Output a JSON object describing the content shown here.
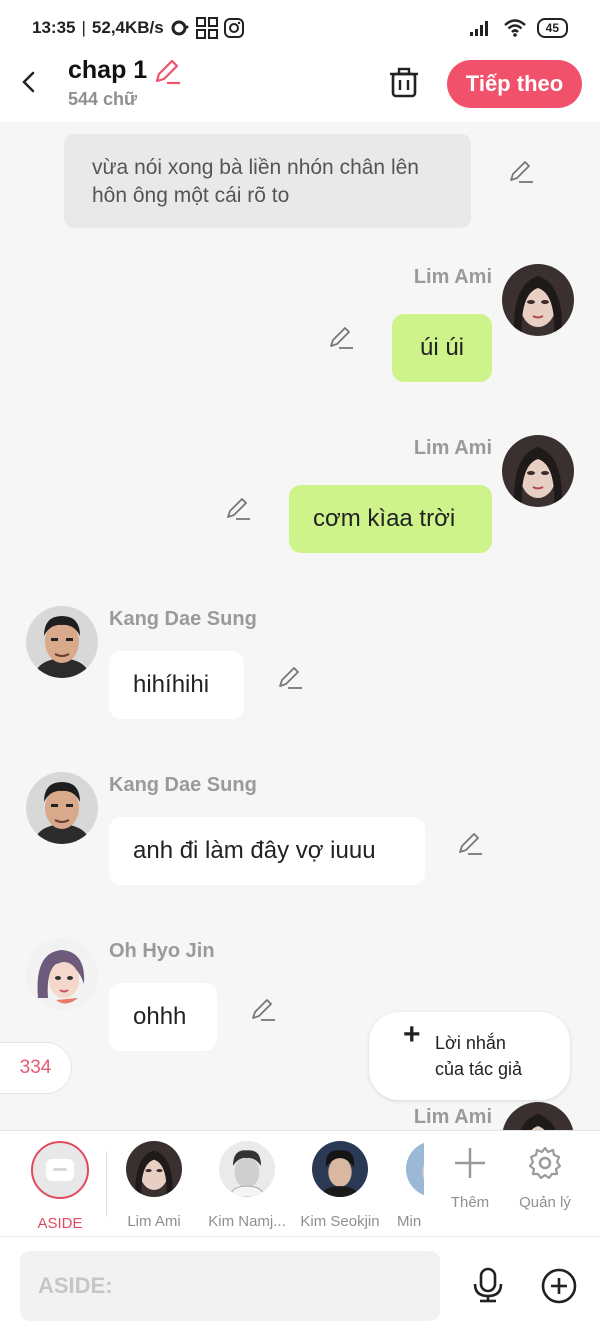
{
  "status_bar": {
    "time": "13:35",
    "speed": "52,4KB/s",
    "battery": "45"
  },
  "header": {
    "title": "chap 1",
    "subtitle": "544 chữ",
    "next_label": "Tiếp theo"
  },
  "messages": [
    {
      "type": "narration",
      "text": "vừa nói xong bà liền nhón chân lên hôn ông một cái rõ to"
    },
    {
      "type": "right",
      "name": "Lim Ami",
      "text": "úi úi"
    },
    {
      "type": "right",
      "name": "Lim Ami",
      "text": "cơm kìaa trời"
    },
    {
      "type": "left",
      "name": "Kang Dae Sung",
      "text": "hihíhihi"
    },
    {
      "type": "left",
      "name": "Kang Dae Sung",
      "text": "anh đi làm đây vợ iuuu"
    },
    {
      "type": "left",
      "name": "Oh Hyo Jin",
      "text": "ohhh"
    },
    {
      "type": "right",
      "name": "Lim Ami",
      "text": ""
    }
  ],
  "count_badge": "334",
  "author_note": {
    "line1": "Lời nhắn",
    "line2": "của tác giả"
  },
  "characters": [
    {
      "label": "ASIDE"
    },
    {
      "label": "Lim Ami"
    },
    {
      "label": "Kim Namj..."
    },
    {
      "label": "Kim Seokjin"
    },
    {
      "label": "Min"
    }
  ],
  "tools": {
    "add_label": "Thêm",
    "manage_label": "Quản lý"
  },
  "input": {
    "placeholder": "ASIDE:"
  },
  "colors": {
    "accent": "#f2516c",
    "green_bubble": "#cdf38a",
    "aside_active": "#e14a5f"
  }
}
